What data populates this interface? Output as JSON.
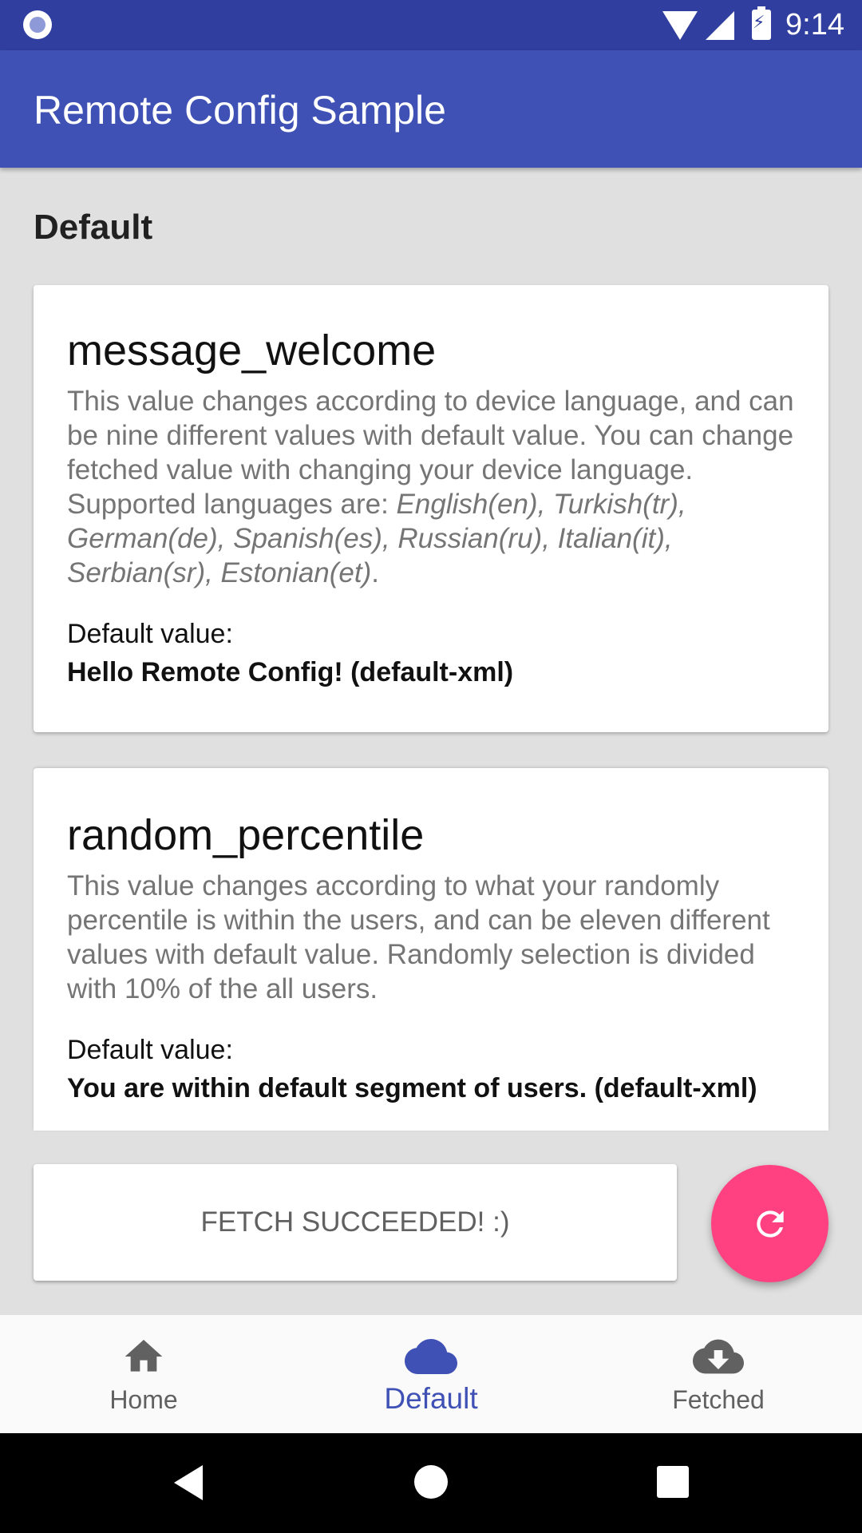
{
  "status_bar": {
    "time": "9:14"
  },
  "app_bar": {
    "title": "Remote Config Sample"
  },
  "section": {
    "heading": "Default"
  },
  "cards": [
    {
      "key": "message_welcome",
      "description_plain": "This value changes according to device language, and can be nine different values with default value. You can change fetched value with changing your device language. Supported languages are: ",
      "description_italic": "English(en), Turkish(tr), German(de), Spanish(es), Russian(ru), Italian(it), Serbian(sr), Estonian(et)",
      "description_end": ".",
      "default_label": "Default value:",
      "default_value": "Hello Remote Config! (default-xml)"
    },
    {
      "key": "random_percentile",
      "description_plain": "This value changes according to what your randomly percentile is within the users, and can be eleven different values with default value. Randomly selection is divided with 10% of the all users.",
      "default_label": "Default value:",
      "default_value": "You are within default segment of users. (default-xml)"
    }
  ],
  "fetch_status": {
    "text": "FETCH SUCCEEDED! :)"
  },
  "fab": {
    "icon": "refresh-icon",
    "color": "#ff4081"
  },
  "bottom_nav": {
    "items": [
      {
        "label": "Home",
        "icon": "home-icon",
        "active": false
      },
      {
        "label": "Default",
        "icon": "cloud-icon",
        "active": true
      },
      {
        "label": "Fetched",
        "icon": "cloud-download-icon",
        "active": false
      }
    ]
  },
  "colors": {
    "primary": "#3f51b5",
    "primary_dark": "#303f9f",
    "accent": "#ff4081"
  }
}
